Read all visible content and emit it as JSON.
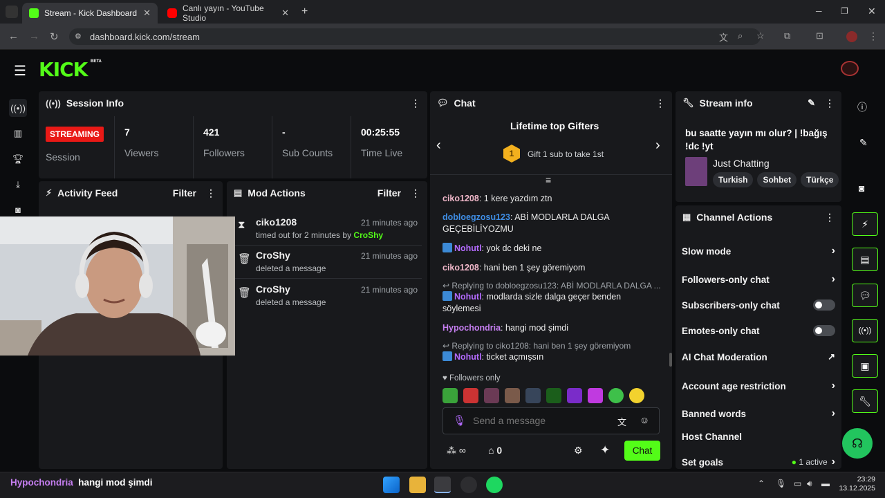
{
  "browser": {
    "tabs": [
      {
        "title": "Stream - Kick Dashboard",
        "active": true,
        "favicon": "kick-favicon"
      },
      {
        "title": "Canlı yayın - YouTube Studio",
        "active": false,
        "favicon": "youtube-favicon"
      }
    ],
    "url": "dashboard.kick.com/stream"
  },
  "app": {
    "logo": "KICK",
    "logo_badge": "BETA"
  },
  "session": {
    "title": "Session Info",
    "status_badge": "STREAMING",
    "session_label": "Session",
    "stats": [
      {
        "value": "7",
        "label": "Viewers"
      },
      {
        "value": "421",
        "label": "Followers"
      },
      {
        "value": "-",
        "label": "Sub Counts"
      },
      {
        "value": "00:25:55",
        "label": "Time Live"
      }
    ]
  },
  "activity": {
    "title": "Activity Feed",
    "filter": "Filter"
  },
  "mod_actions": {
    "title": "Mod Actions",
    "filter": "Filter",
    "items": [
      {
        "user": "ciko1208",
        "time": "21 minutes ago",
        "desc": "timed out for 2 minutes by",
        "by": "CroShy",
        "icon": "hourglass-icon"
      },
      {
        "user": "CroShy",
        "time": "21 minutes ago",
        "desc": "deleted a message",
        "by": "",
        "icon": "trash-icon"
      },
      {
        "user": "CroShy",
        "time": "21 minutes ago",
        "desc": "deleted a message",
        "by": "",
        "icon": "trash-icon"
      }
    ]
  },
  "chat": {
    "title": "Chat",
    "gifters_title": "Lifetime top Gifters",
    "gifters_rank": "1",
    "gifters_cta": "Gift 1 sub to take 1st",
    "messages": [
      {
        "user": "ciko1208",
        "text": "1 kere yazdım ztn",
        "color": "#f0b7c9"
      },
      {
        "user": "dobloegzosu123",
        "text": "ABİ MODLARLA DALGA GEÇEBİLİYOZMU",
        "color": "#3f8ee6"
      },
      {
        "user": "Nohutl",
        "text": "yok dc deki ne",
        "color": "#b46bff"
      },
      {
        "user": "ciko1208",
        "text": "hani ben 1 şey göremiyom",
        "color": "#f0b7c9"
      },
      {
        "user": "Nohutl",
        "text": "modlarda sizle dalga geçer benden söylemesi",
        "color": "#b46bff",
        "reply": "Replying to dobloegzosu123: ABİ MODLARLA DALGA ..."
      },
      {
        "user": "Hypochondria",
        "text": "hangi mod şimdi",
        "color": "#c57ef0"
      },
      {
        "user": "Nohutl",
        "text": "ticket açmışsın",
        "color": "#b46bff",
        "reply": "Replying to ciko1208: hani ben 1 şey göremiyom"
      }
    ],
    "followers_only": "Followers only",
    "input_placeholder": "Send a message",
    "points": "0",
    "send_label": "Chat"
  },
  "stream_info": {
    "title": "Stream info",
    "stream_title": "bu saatte yayın mı olur? | !bağış !dc !yt",
    "category": "Just Chatting",
    "tags": [
      "Turkish",
      "Sohbet",
      "Türkçe"
    ]
  },
  "channel_actions": {
    "title": "Channel Actions",
    "items": [
      {
        "label": "Slow mode",
        "control": "chevron"
      },
      {
        "label": "Followers-only chat",
        "control": "chevron"
      },
      {
        "label": "Subscribers-only chat",
        "control": "toggle"
      },
      {
        "label": "Emotes-only chat",
        "control": "toggle"
      },
      {
        "label": "AI Chat Moderation",
        "control": "external"
      },
      {
        "label": "Account age restriction",
        "control": "chevron"
      },
      {
        "label": "Banned words",
        "control": "chevron"
      },
      {
        "label": "Host Channel",
        "control": "none"
      },
      {
        "label": "Set goals",
        "control": "chevron",
        "status": "1 active"
      }
    ]
  },
  "overlay": {
    "user": "Hypochondria",
    "text": "hangi mod şimdi"
  },
  "taskbar": {
    "time": "23:29",
    "date": "13.12.2025"
  },
  "colors": {
    "accent": "#53fc18",
    "live": "#e91916",
    "panel": "#18191c"
  }
}
